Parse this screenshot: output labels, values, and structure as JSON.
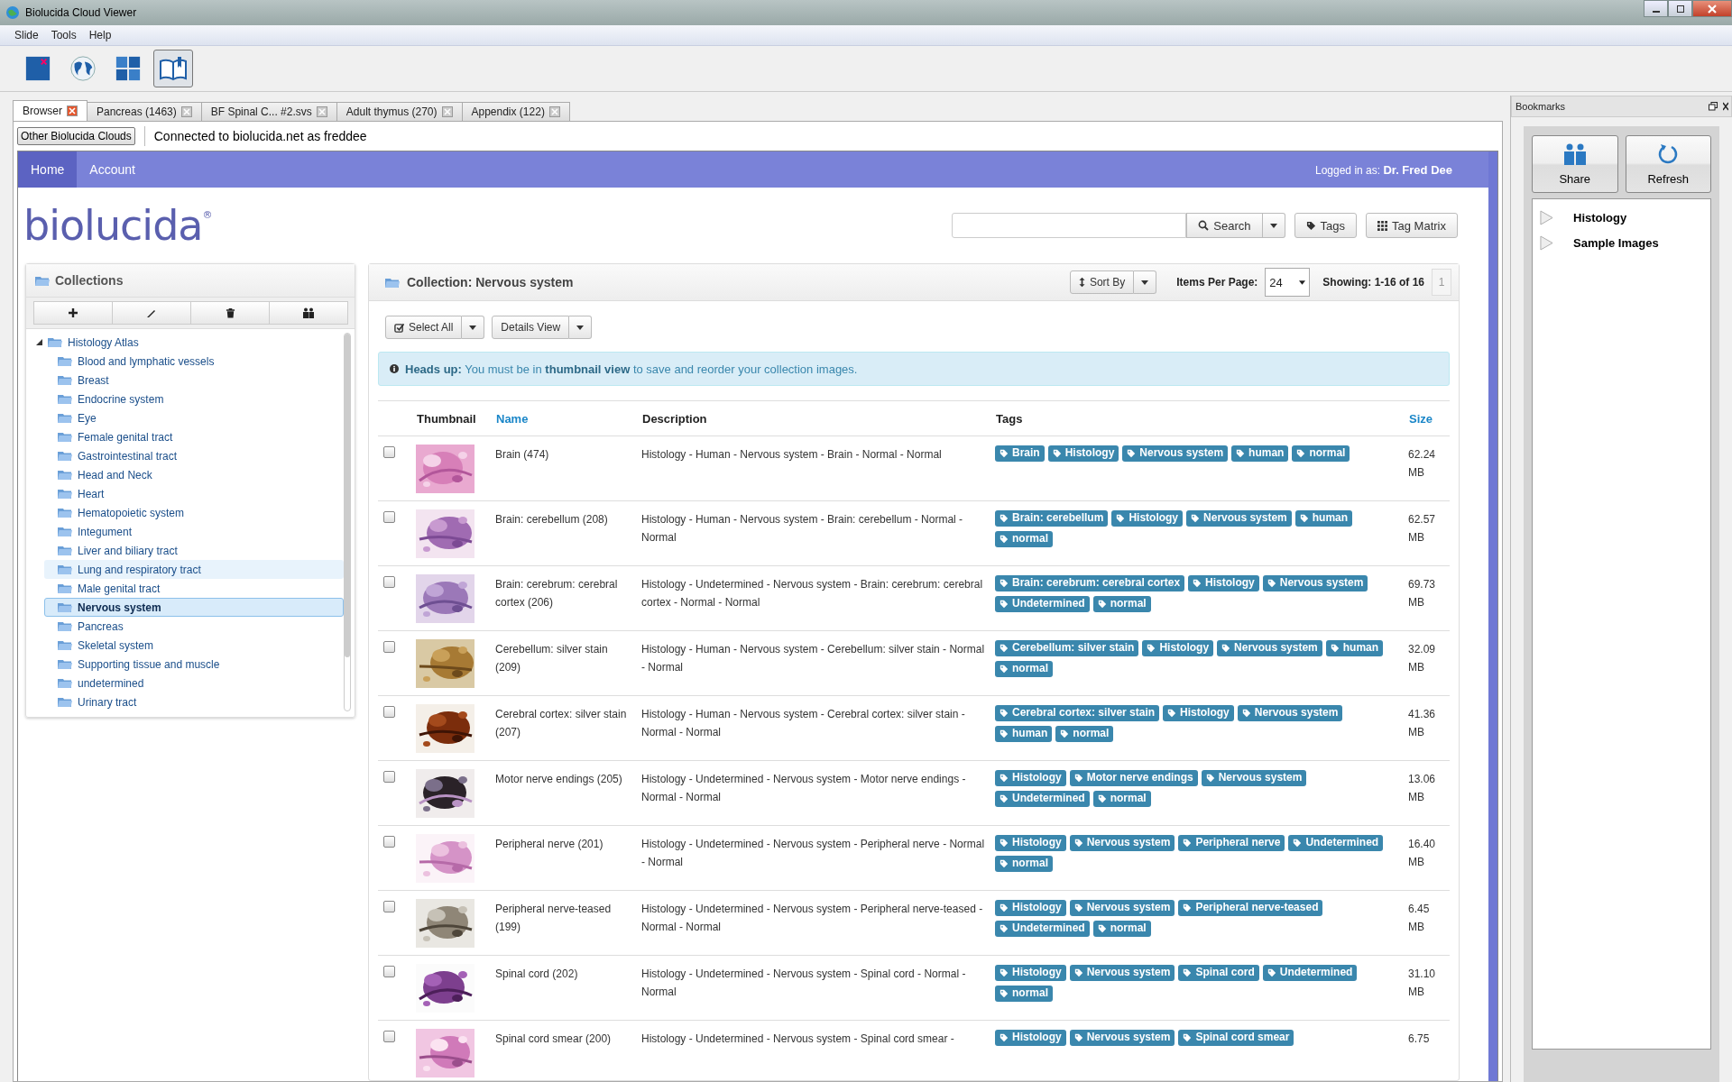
{
  "window": {
    "title": "Biolucida Cloud Viewer"
  },
  "menu": [
    "Slide",
    "Tools",
    "Help"
  ],
  "toolbar": [
    {
      "kind": "slide",
      "selected": false
    },
    {
      "kind": "globe",
      "selected": false
    },
    {
      "kind": "layout",
      "selected": false
    },
    {
      "kind": "book",
      "selected": true
    }
  ],
  "tabs": [
    {
      "label": "Browser",
      "selected": true
    },
    {
      "label": "Pancreas (1463)",
      "selected": false
    },
    {
      "label": "BF Spinal C... #2.svs",
      "selected": false
    },
    {
      "label": "Adult thymus (270)",
      "selected": false
    },
    {
      "label": "Appendix (122)",
      "selected": false
    }
  ],
  "connection": {
    "button": "Other Biolucida Clouds",
    "status": "Connected to biolucida.net as freddee"
  },
  "site": {
    "nav": [
      {
        "label": "Home",
        "selected": true
      },
      {
        "label": "Account",
        "selected": false
      }
    ],
    "logged_in": "Logged in as: **Dr. Fred Dee**",
    "logo": "biolucida$^{®}$",
    "search_button": "Search",
    "tags_button": "Tags",
    "tag_matrix_button": "Tag Matrix"
  },
  "collections": {
    "title": "Collections",
    "tree": [
      {
        "label": "Histology Atlas",
        "expanded": true,
        "selected": false,
        "hovered": false,
        "children": [
          {
            "label": "Blood and lymphatic vessels",
            "selected": false,
            "hovered": false
          },
          {
            "label": "Breast",
            "selected": false,
            "hovered": false
          },
          {
            "label": "Endocrine system",
            "selected": false,
            "hovered": false
          },
          {
            "label": "Eye",
            "selected": false,
            "hovered": false
          },
          {
            "label": "Female genital tract",
            "selected": false,
            "hovered": false
          },
          {
            "label": "Gastrointestinal tract",
            "selected": false,
            "hovered": false
          },
          {
            "label": "Head and Neck",
            "selected": false,
            "hovered": false
          },
          {
            "label": "Heart",
            "selected": false,
            "hovered": false
          },
          {
            "label": "Hematopoietic system",
            "selected": false,
            "hovered": false
          },
          {
            "label": "Integument",
            "selected": false,
            "hovered": false
          },
          {
            "label": "Liver and biliary tract",
            "selected": false,
            "hovered": false
          },
          {
            "label": "Lung and respiratory tract",
            "selected": false,
            "hovered": true
          },
          {
            "label": "Male genital tract",
            "selected": false,
            "hovered": false
          },
          {
            "label": "Nervous system",
            "selected": true,
            "hovered": false
          },
          {
            "label": "Pancreas",
            "selected": false,
            "hovered": false
          },
          {
            "label": "Skeletal system",
            "selected": false,
            "hovered": false
          },
          {
            "label": "Supporting tissue and muscle",
            "selected": false,
            "hovered": false
          },
          {
            "label": "undetermined",
            "selected": false,
            "hovered": false
          },
          {
            "label": "Urinary tract",
            "selected": false,
            "hovered": false
          }
        ]
      }
    ]
  },
  "collection": {
    "title": "Collection: Nervous system",
    "sort_button": "Sort By",
    "items_per_page_label": "Items Per Page:",
    "items_per_page": "24",
    "showing": "Showing: 1-16 of 16",
    "page": "1",
    "select_all": "Select All",
    "view": "Details View",
    "alert": "**Heads up:** You must be in **thumbnail view** to save and reorder your collection images.",
    "columns": [
      {
        "label": "Thumbnail",
        "sortable": false
      },
      {
        "label": "Name",
        "sortable": true
      },
      {
        "label": "Description",
        "sortable": false
      },
      {
        "label": "Tags",
        "sortable": false
      },
      {
        "label": "Size",
        "sortable": true
      }
    ],
    "rows": [
      {
        "checked": false,
        "name": "Brain (474)",
        "description": "Histology - Human - Nervous system - Brain - Normal - Normal",
        "tags": [
          "Brain",
          "Histology",
          "Nervous system",
          "human",
          "normal"
        ],
        "size": "62.24 MB"
      },
      {
        "checked": false,
        "name": "Brain: cerebellum (208)",
        "description": "Histology - Human - Nervous system - Brain: cerebellum - Normal - Normal",
        "tags": [
          "Brain: cerebellum",
          "Histology",
          "Nervous system",
          "human",
          "normal"
        ],
        "size": "62.57 MB"
      },
      {
        "checked": false,
        "name": "Brain: cerebrum: cerebral cortex (206)",
        "description": "Histology - Undetermined - Nervous system - Brain: cerebrum: cerebral cortex - Normal - Normal",
        "tags": [
          "Brain: cerebrum: cerebral cortex",
          "Histology",
          "Nervous system",
          "Undetermined",
          "normal"
        ],
        "size": "69.73 MB"
      },
      {
        "checked": false,
        "name": "Cerebellum: silver stain (209)",
        "description": "Histology - Human - Nervous system - Cerebellum: silver stain - Normal - Normal",
        "tags": [
          "Cerebellum: silver stain",
          "Histology",
          "Nervous system",
          "human",
          "normal"
        ],
        "size": "32.09 MB"
      },
      {
        "checked": false,
        "name": "Cerebral cortex: silver stain (207)",
        "description": "Histology - Human - Nervous system - Cerebral cortex: silver stain - Normal - Normal",
        "tags": [
          "Cerebral cortex: silver stain",
          "Histology",
          "Nervous system",
          "human",
          "normal"
        ],
        "size": "41.36 MB"
      },
      {
        "checked": false,
        "name": "Motor nerve endings (205)",
        "description": "Histology - Undetermined - Nervous system - Motor nerve endings - Normal - Normal",
        "tags": [
          "Histology",
          "Motor nerve endings",
          "Nervous system",
          "Undetermined",
          "normal"
        ],
        "size": "13.06 MB"
      },
      {
        "checked": false,
        "name": "Peripheral nerve (201)",
        "description": "Histology - Undetermined - Nervous system - Peripheral nerve - Normal - Normal",
        "tags": [
          "Histology",
          "Nervous system",
          "Peripheral nerve",
          "Undetermined",
          "normal"
        ],
        "size": "16.40 MB"
      },
      {
        "checked": false,
        "name": "Peripheral nerve-teased (199)",
        "description": "Histology - Undetermined - Nervous system - Peripheral nerve-teased - Normal - Normal",
        "tags": [
          "Histology",
          "Nervous system",
          "Peripheral nerve-teased",
          "Undetermined",
          "normal"
        ],
        "size": "6.45 MB"
      },
      {
        "checked": false,
        "name": "Spinal cord (202)",
        "description": "Histology - Undetermined - Nervous system - Spinal cord - Normal - Normal",
        "tags": [
          "Histology",
          "Nervous system",
          "Spinal cord",
          "Undetermined",
          "normal"
        ],
        "size": "31.10 MB"
      },
      {
        "checked": false,
        "name": "Spinal cord smear (200)",
        "description": "Histology - Undetermined - Nervous system - Spinal cord smear -",
        "tags": [
          "Histology",
          "Nervous system",
          "Spinal cord smear"
        ],
        "size": "6.75"
      }
    ]
  },
  "bookmarks": {
    "title": "Bookmarks",
    "buttons": [
      {
        "kind": "share",
        "label": "Share"
      },
      {
        "kind": "refresh",
        "label": "Refresh"
      }
    ],
    "items": [
      {
        "label": "Histology",
        "expanded": false
      },
      {
        "label": "Sample Images",
        "expanded": false
      }
    ]
  }
}
